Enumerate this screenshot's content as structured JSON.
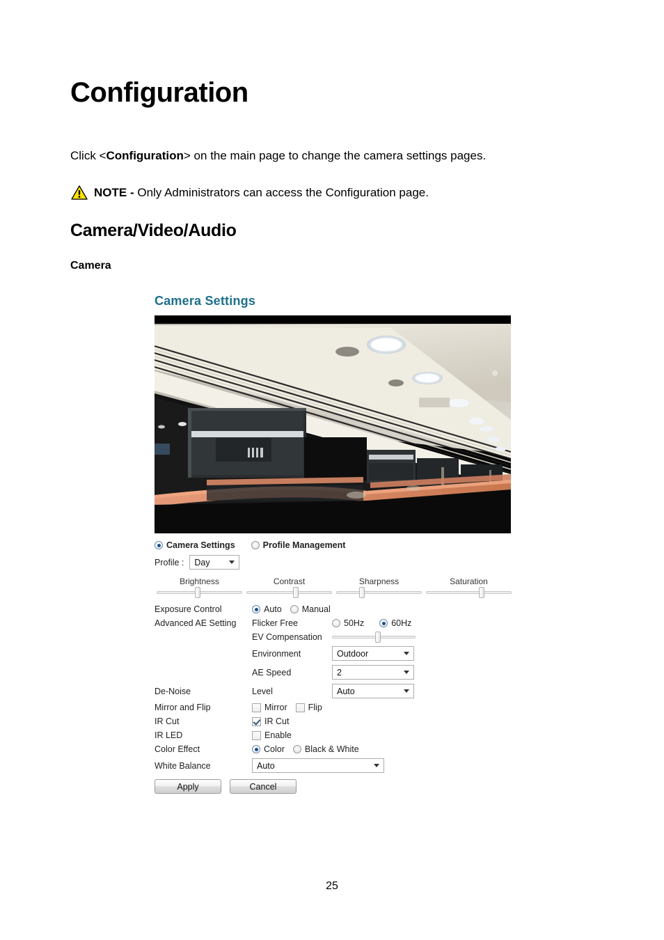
{
  "document": {
    "title": "Configuration",
    "intro_prefix": "Click <",
    "intro_bold": "Configuration",
    "intro_suffix": "> on the main page to change the camera settings pages.",
    "note_label": "NOTE - ",
    "note_text": "Only Administrators can access the Configuration page.",
    "section_heading": "Camera/Video/Audio",
    "subsection_heading": "Camera",
    "page_number": "25"
  },
  "screenshot": {
    "panel_title": "Camera Settings",
    "panel_title_color": "#1d6f8c",
    "mode": {
      "camera_settings_label": "Camera Settings",
      "camera_settings_selected": true,
      "profile_management_label": "Profile Management",
      "profile_management_selected": false
    },
    "profile": {
      "label": "Profile :",
      "value": "Day"
    },
    "sliders": {
      "brightness": {
        "label": "Brightness",
        "percent": 48
      },
      "contrast": {
        "label": "Contrast",
        "percent": 58
      },
      "sharpness": {
        "label": "Sharpness",
        "percent": 30
      },
      "saturation": {
        "label": "Saturation",
        "percent": 65
      }
    },
    "exposure": {
      "label": "Exposure Control",
      "auto_label": "Auto",
      "auto_selected": true,
      "manual_label": "Manual",
      "manual_selected": false
    },
    "advanced_ae": {
      "label": "Advanced AE Setting",
      "flicker_label": "Flicker Free",
      "hz50_label": "50Hz",
      "hz50_selected": false,
      "hz60_label": "60Hz",
      "hz60_selected": true,
      "ev_label": "EV Compensation",
      "ev_percent": 55,
      "environment_label": "Environment",
      "environment_value": "Outdoor",
      "ae_speed_label": "AE Speed",
      "ae_speed_value": "2"
    },
    "denoise": {
      "label": "De-Noise",
      "level_label": "Level",
      "level_value": "Auto"
    },
    "mirror_flip": {
      "label": "Mirror and Flip",
      "mirror_label": "Mirror",
      "mirror_checked": false,
      "flip_label": "Flip",
      "flip_checked": false
    },
    "ir_cut": {
      "label": "IR Cut",
      "checkbox_label": "IR Cut",
      "checked": true
    },
    "ir_led": {
      "label": "IR LED",
      "checkbox_label": "Enable",
      "checked": false
    },
    "color_effect": {
      "label": "Color Effect",
      "color_label": "Color",
      "color_selected": true,
      "bw_label": "Black & White",
      "bw_selected": false
    },
    "white_balance": {
      "label": "White Balance",
      "value": "Auto"
    },
    "buttons": {
      "apply": "Apply",
      "cancel": "Cancel"
    },
    "video_preview": {
      "description": "Live camera view of an office interior ceiling with recessed lights, glass partitions and a wooden counter"
    }
  }
}
